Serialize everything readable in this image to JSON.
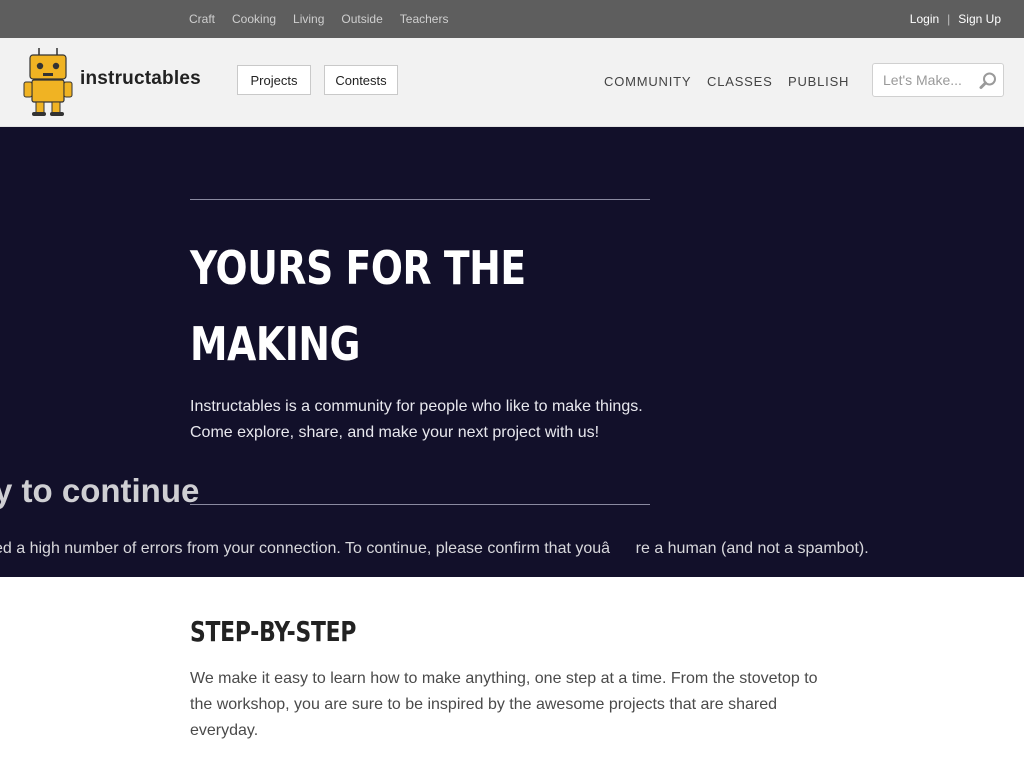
{
  "topbar": {
    "categories": [
      "Craft",
      "Cooking",
      "Living",
      "Outside",
      "Teachers"
    ],
    "login": "Login",
    "separator": "|",
    "signup": "Sign Up"
  },
  "header": {
    "logo_text": "instructables",
    "projects_label": "Projects",
    "contests_label": "Contests",
    "nav": {
      "community": "COMMUNITY",
      "classes": "CLASSES",
      "publish": "PUBLISH"
    },
    "search": {
      "placeholder": "Let's Make..."
    }
  },
  "hero": {
    "title_line1": "YOURS FOR THE",
    "title_line2": "MAKING",
    "description": "Instructables is a community for people who like to make things. Come explore, share, and make your next project with us!",
    "overlay_heading": "y to continue",
    "overlay_message": "ed a high number of errors from your connection. To continue, please confirm that youâre a human (and not a spambot)."
  },
  "content": {
    "section_title": "STEP-BY-STEP",
    "section_text": "We make it easy to learn how to make anything, one step at a time. From the stovetop to the workshop, you are sure to be inspired by the awesome projects that are shared everyday."
  },
  "colors": {
    "topbar_bg": "#5e5e5e",
    "header_bg": "#f2f2f2",
    "hero_bg": "#12102a",
    "robot_yellow": "#f0b323"
  },
  "icons": {
    "logo": "robot-mascot-icon",
    "search": "search-icon"
  }
}
